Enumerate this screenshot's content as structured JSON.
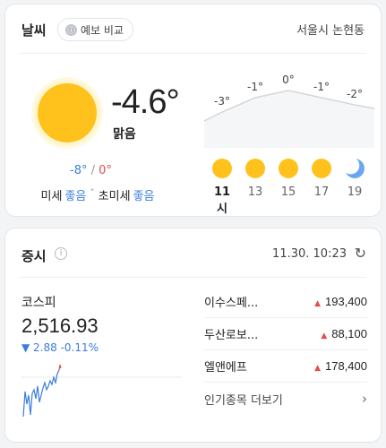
{
  "weather": {
    "title": "날씨",
    "compare_label": "예보 비교",
    "compare_icon": "info-icon",
    "location": "서울시 논현동",
    "current_temp": "-4.6°",
    "condition": "맑음",
    "low": "-8°",
    "separator": "/",
    "high": "0°",
    "air_label": "미세",
    "air_value": "좋음",
    "fine_air_label": "초미세",
    "fine_air_value": "좋음",
    "hourly": [
      {
        "time": "11시",
        "temp": "-3°",
        "temp_value": -3,
        "icon": "sun-icon",
        "now": true
      },
      {
        "time": "13",
        "temp": "-1°",
        "temp_value": -1,
        "icon": "sun-icon",
        "now": false
      },
      {
        "time": "15",
        "temp": "0°",
        "temp_value": 0,
        "icon": "sun-icon",
        "now": false
      },
      {
        "time": "17",
        "temp": "-1°",
        "temp_value": -1,
        "icon": "sun-icon",
        "now": false
      },
      {
        "time": "19",
        "temp": "-2°",
        "temp_value": -2,
        "icon": "moon-icon",
        "now": false
      }
    ],
    "colors": {
      "sun": "#ffc21c",
      "moon": "#6aa7f0",
      "low": "#3b7ddd",
      "high": "#e44c4c"
    }
  },
  "stocks": {
    "title": "증시",
    "timestamp": "11.30. 10:23",
    "index_name": "코스피",
    "index_value": "2,516.93",
    "index_change": "▼ 2.88  -0.11%",
    "items": [
      {
        "name": "이수스페...",
        "price": "193,400"
      },
      {
        "name": "두산로보...",
        "price": "88,100"
      },
      {
        "name": "엘앤에프",
        "price": "178,400"
      }
    ],
    "more_label": "인기종목 더보기",
    "colors": {
      "up": "#e44c4c",
      "down": "#3b7ddd"
    }
  }
}
